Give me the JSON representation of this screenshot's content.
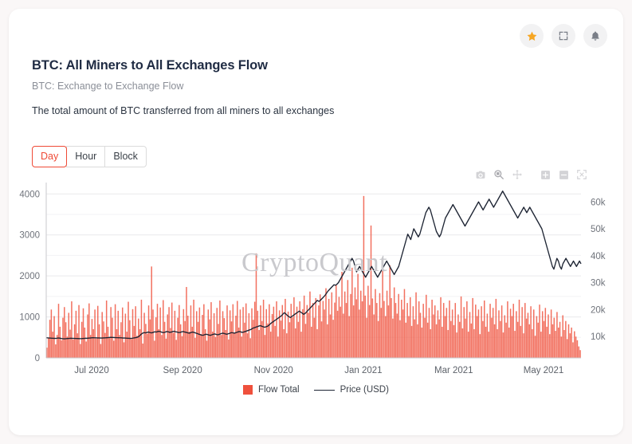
{
  "header": {
    "title": "BTC: All Miners to All Exchanges Flow",
    "subtitle": "BTC: Exchange to Exchange Flow",
    "description": "The total amount of BTC transferred from all miners to all exchanges",
    "actions": [
      {
        "name": "favorite-star-button",
        "icon": "star-icon",
        "color": "#f6a623"
      },
      {
        "name": "fullscreen-button",
        "icon": "expand-icon",
        "color": "#7a7f88"
      },
      {
        "name": "alert-bell-button",
        "icon": "bell-icon",
        "color": "#7a7f88"
      }
    ]
  },
  "interval": {
    "options": [
      "Day",
      "Hour",
      "Block"
    ],
    "selected": "Day",
    "active_color": "#ef4a36"
  },
  "modebar": {
    "buttons": [
      {
        "name": "download-plot-icon",
        "label": "camera",
        "active": false
      },
      {
        "name": "zoom-select-icon",
        "label": "zoom",
        "active": true
      },
      {
        "name": "pan-icon",
        "label": "pan",
        "active": false
      },
      {
        "name": "zoom-in-icon",
        "label": "zoom-in",
        "active": false
      },
      {
        "name": "zoom-out-icon",
        "label": "zoom-out",
        "active": false
      },
      {
        "name": "autoscale-icon",
        "label": "autoscale",
        "active": false
      }
    ]
  },
  "watermark": "CryptoQuant",
  "chart_data": {
    "type": "bar",
    "title": "BTC: All Miners to All Exchanges Flow",
    "subtitle": "BTC: Exchange to Exchange Flow",
    "xlabel": "",
    "ylabel": "",
    "grid": true,
    "legend_position": "bottom-center",
    "x_tick_labels": [
      "Jul 2020",
      "Sep 2020",
      "Nov 2020",
      "Jan 2021",
      "Mar 2021",
      "May 2021"
    ],
    "x_tick_positions": [
      0.085,
      0.255,
      0.425,
      0.593,
      0.762,
      0.93
    ],
    "x_range": [
      "2020-06-10",
      "2021-06-05"
    ],
    "yaxis_left": {
      "label": "Flow Total",
      "ticks": [
        0,
        1000,
        2000,
        3000,
        4000
      ],
      "tick_labels": [
        "0",
        "1000",
        "2000",
        "3000",
        "4000"
      ],
      "range": [
        0,
        4200
      ]
    },
    "yaxis_right": {
      "label": "Price (USD)",
      "ticks": [
        10000,
        20000,
        30000,
        40000,
        50000,
        60000
      ],
      "tick_labels": [
        "10k",
        "20k",
        "30k",
        "40k",
        "50k",
        "60k"
      ],
      "range": [
        2000,
        66000
      ]
    },
    "series": [
      {
        "name": "Flow Total",
        "type": "bar",
        "color": "#ef503c",
        "axis": "left",
        "values": [
          250,
          480,
          930,
          1180,
          640,
          1020,
          330,
          560,
          1320,
          760,
          430,
          980,
          1240,
          870,
          520,
          1100,
          690,
          1380,
          450,
          820,
          1150,
          600,
          1290,
          340,
          880,
          1210,
          740,
          400,
          1060,
          1330,
          560,
          950,
          700,
          1180,
          470,
          1270,
          820,
          340,
          1120,
          890,
          610,
          1400,
          760,
          500,
          1240,
          980,
          420,
          1310,
          700,
          1150,
          560,
          870,
          1230,
          380,
          1080,
          640,
          1370,
          920,
          460,
          1190,
          780,
          1260,
          540,
          960,
          700,
          1420,
          350,
          1100,
          830,
          590,
          1280,
          940,
          2230,
          1180,
          420,
          990,
          1320,
          700,
          1230,
          560,
          1410,
          880,
          470,
          1060,
          1240,
          730,
          1350,
          610,
          1150,
          440,
          980,
          1290,
          820,
          530,
          1190,
          900,
          1730,
          1030,
          640,
          1280,
          760,
          1420,
          490,
          1140,
          880,
          1230,
          580,
          1050,
          1310,
          700,
          420,
          1180,
          940,
          1360,
          640,
          1090,
          510,
          1220,
          830,
          1400,
          560,
          1140,
          970,
          680,
          1280,
          450,
          1160,
          890,
          1310,
          620,
          1030,
          1390,
          740,
          1180,
          520,
          1240,
          860,
          1330,
          600,
          1090,
          480,
          1210,
          930,
          1370,
          2550,
          1150,
          680,
          1280,
          900,
          1420,
          560,
          1190,
          840,
          1310,
          640,
          1070,
          1250,
          780,
          1380,
          520,
          1160,
          910,
          1290,
          700,
          1440,
          600,
          1130,
          870,
          1320,
          990,
          1480,
          720,
          1250,
          880,
          1380,
          640,
          1190,
          1520,
          830,
          1290,
          1100,
          1620,
          760,
          1340,
          980,
          1460,
          700,
          1280,
          1550,
          890,
          1390,
          1180,
          1700,
          820,
          1440,
          1060,
          1600,
          930,
          1350,
          1780,
          1150,
          1490,
          1250,
          2100,
          1080,
          1620,
          1340,
          1900,
          1020,
          1560,
          2200,
          1280,
          1720,
          1430,
          2050,
          1180,
          1640,
          1380,
          3950,
          1520,
          980,
          1760,
          1290,
          3230,
          1450,
          1060,
          1680,
          1340,
          900,
          1580,
          1220,
          2230,
          1390,
          1020,
          1640,
          1280,
          2260,
          1460,
          960,
          1720,
          1340,
          1080,
          1560,
          920,
          1420,
          1180,
          1680,
          860,
          1340,
          1020,
          1480,
          780,
          1260,
          940,
          1600,
          820,
          1380,
          1100,
          740,
          1320,
          980,
          1540,
          860,
          1220,
          700,
          1420,
          1060,
          1280,
          820,
          1160,
          940,
          1480,
          760,
          1340,
          1020,
          1220,
          680,
          1400,
          900,
          1180,
          800,
          1340,
          620,
          1060,
          880,
          1500,
          720,
          1240,
          960,
          1380,
          640,
          1120,
          840,
          1460,
          700,
          1300,
          1020,
          1180,
          580,
          1260,
          900,
          1400,
          760,
          1080,
          640,
          1320,
          980,
          1220,
          820,
          1440,
          700,
          1160,
          900,
          1280,
          620,
          1040,
          860,
          1380,
          740,
          1200,
          1020,
          1320,
          660,
          1140,
          880,
          1420,
          780,
          1240,
          600,
          1340,
          960,
          1100,
          820,
          1260,
          700,
          1180,
          540,
          1020,
          860,
          1300,
          640,
          1140,
          900,
          1220,
          760,
          1060,
          580,
          1180,
          820,
          980,
          660,
          1120,
          740,
          880,
          520,
          1040,
          680,
          900,
          460,
          820,
          600,
          740,
          380,
          650,
          520,
          430,
          280,
          190
        ]
      },
      {
        "name": "Price (USD)",
        "type": "line",
        "color": "#1d2433",
        "axis": "right",
        "values": [
          9500,
          9450,
          9400,
          9350,
          9300,
          9280,
          9250,
          9300,
          9400,
          9350,
          9200,
          9150,
          9100,
          9150,
          9200,
          9250,
          9300,
          9280,
          9260,
          9240,
          9220,
          9200,
          9180,
          9150,
          9200,
          9250,
          9300,
          9280,
          9350,
          9400,
          9450,
          9500,
          9480,
          9460,
          9440,
          9420,
          9400,
          9380,
          9420,
          9450,
          9500,
          9550,
          9600,
          9650,
          9620,
          9580,
          9550,
          9520,
          9500,
          9480,
          9450,
          9400,
          9380,
          9350,
          9300,
          9280,
          9250,
          9300,
          9400,
          9500,
          9600,
          9800,
          10200,
          10800,
          11200,
          11400,
          11300,
          11500,
          11600,
          11400,
          11300,
          11500,
          11700,
          11600,
          11800,
          11900,
          11700,
          11500,
          11400,
          11600,
          11800,
          11700,
          11500,
          11600,
          11800,
          11900,
          11700,
          11600,
          11400,
          11500,
          11700,
          11800,
          11600,
          11500,
          11300,
          11200,
          11400,
          11600,
          11500,
          11300,
          11100,
          10900,
          10700,
          10500,
          10400,
          10600,
          10800,
          10700,
          10500,
          10400,
          10600,
          10800,
          10900,
          10700,
          10600,
          10800,
          11000,
          11200,
          11100,
          10900,
          10800,
          11000,
          11200,
          11400,
          11300,
          11200,
          11400,
          11600,
          11800,
          11700,
          11500,
          11600,
          11800,
          12000,
          12200,
          12400,
          12600,
          13000,
          13200,
          13400,
          13600,
          13800,
          14000,
          13800,
          13600,
          13400,
          13600,
          13800,
          14200,
          14800,
          15200,
          15600,
          16000,
          16400,
          16800,
          17200,
          17600,
          18200,
          18800,
          18400,
          17800,
          17400,
          17000,
          17400,
          17800,
          18200,
          18600,
          19000,
          19400,
          19000,
          18600,
          18200,
          18600,
          19200,
          19800,
          20400,
          21000,
          21600,
          22200,
          22800,
          23400,
          23000,
          23400,
          24000,
          24600,
          25200,
          26000,
          26800,
          27400,
          28000,
          28600,
          29200,
          29000,
          29400,
          30000,
          31000,
          32000,
          33000,
          34000,
          35000,
          36000,
          37000,
          38000,
          39000,
          38000,
          36000,
          34000,
          35000,
          36000,
          35000,
          34000,
          33000,
          32000,
          33000,
          34000,
          35000,
          36000,
          35000,
          34000,
          33000,
          32000,
          33000,
          34000,
          35000,
          36000,
          37000,
          38000,
          37000,
          36000,
          35000,
          34000,
          33000,
          34000,
          35000,
          36000,
          38000,
          40000,
          42000,
          44000,
          46000,
          48000,
          47000,
          46000,
          48000,
          50000,
          49000,
          48000,
          47000,
          48000,
          50000,
          52000,
          54000,
          56000,
          57000,
          58000,
          57000,
          55000,
          53000,
          51000,
          49000,
          48000,
          47000,
          48000,
          50000,
          52000,
          54000,
          55000,
          56000,
          57000,
          58000,
          59000,
          58000,
          57000,
          56000,
          55000,
          54000,
          53000,
          52000,
          51000,
          52000,
          53000,
          54000,
          55000,
          56000,
          57000,
          58000,
          59000,
          60000,
          59000,
          58000,
          57000,
          58000,
          59000,
          60000,
          61000,
          60000,
          59000,
          58000,
          59000,
          60000,
          61000,
          62000,
          63000,
          64000,
          63000,
          62000,
          61000,
          60000,
          59000,
          58000,
          57000,
          56000,
          55000,
          54000,
          55000,
          56000,
          57000,
          58000,
          57000,
          56000,
          57000,
          58000,
          57000,
          56000,
          55000,
          54000,
          53000,
          52000,
          51000,
          50000,
          48000,
          46000,
          44000,
          42000,
          40000,
          38000,
          36000,
          35000,
          37000,
          39000,
          38000,
          36000,
          35000,
          37000,
          38000,
          39000,
          38000,
          37000,
          36000,
          37000,
          38000,
          37000,
          36000,
          37000,
          38000,
          37000
        ]
      }
    ],
    "legend": [
      {
        "label": "Flow Total",
        "color": "#ef503c",
        "marker": "square"
      },
      {
        "label": "Price (USD)",
        "color": "#1d2433",
        "marker": "line"
      }
    ]
  }
}
